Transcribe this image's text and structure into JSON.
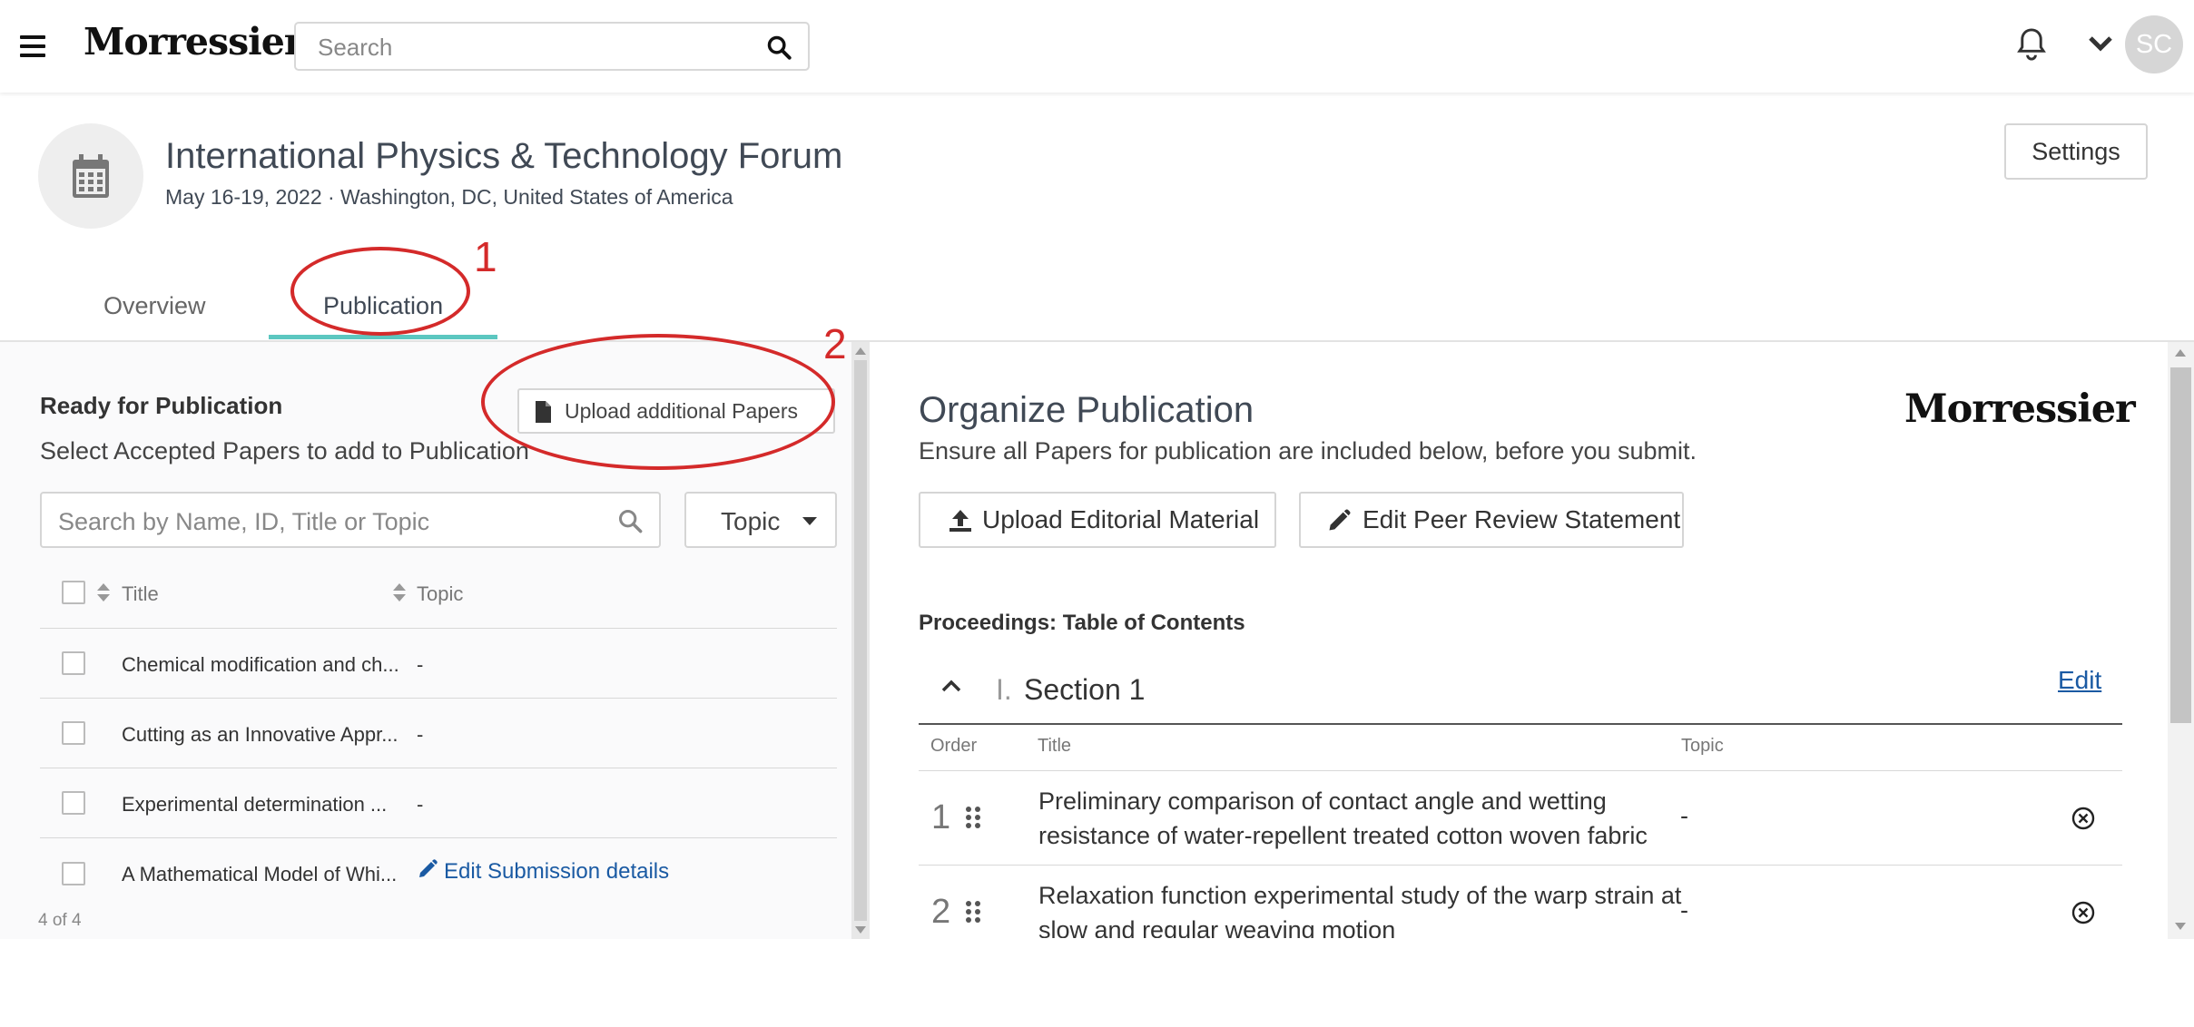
{
  "topbar": {
    "logo": "Morressier",
    "search_placeholder": "Search",
    "avatar_initials": "SC"
  },
  "event": {
    "title": "International Physics & Technology Forum",
    "subtitle": "May 16-19, 2022 · Washington, DC, United States of America",
    "settings_label": "Settings"
  },
  "tabs": [
    {
      "label": "Overview",
      "active": false
    },
    {
      "label": "Publication",
      "active": true
    }
  ],
  "left": {
    "title": "Ready for Publication",
    "subtitle": "Select Accepted Papers to add to Publication",
    "upload_button": "Upload additional Papers",
    "search_placeholder": "Search by Name, ID, Title or Topic",
    "topic_filter": "Topic",
    "columns": [
      "Title",
      "Topic"
    ],
    "rows": [
      {
        "title": "Chemical modification and ch...",
        "topic": "-"
      },
      {
        "title": "Cutting as an Innovative Appr...",
        "topic": "-"
      },
      {
        "title": "Experimental determination ...",
        "topic": "-"
      },
      {
        "title": "A Mathematical Model of Whi...",
        "topic": "Edit Submission details"
      }
    ],
    "count": "4 of 4"
  },
  "right": {
    "title": "Organize Publication",
    "subtitle": "Ensure all Papers for publication are included below, before you submit.",
    "logo": "Morressier",
    "upload_editorial": "Upload Editorial Material",
    "edit_peer_review": "Edit Peer Review Statement",
    "toc_label": "Proceedings: Table of Contents",
    "section": {
      "number": "I.",
      "name": "Section 1",
      "edit": "Edit"
    },
    "columns": [
      "Order",
      "Title",
      "Topic"
    ],
    "papers": [
      {
        "order": "1",
        "title": "Preliminary comparison of contact angle and wetting resistance of water-repellent treated cotton woven fabric",
        "topic": "-"
      },
      {
        "order": "2",
        "title": "Relaxation function experimental study of the warp strain at slow and regular weaving motion",
        "topic": "-"
      }
    ]
  },
  "annotations": [
    "1",
    "2"
  ],
  "colors": {
    "accent_tab": "#5cc7c0",
    "link": "#1a5aa3",
    "annotation": "#d42a2a"
  }
}
